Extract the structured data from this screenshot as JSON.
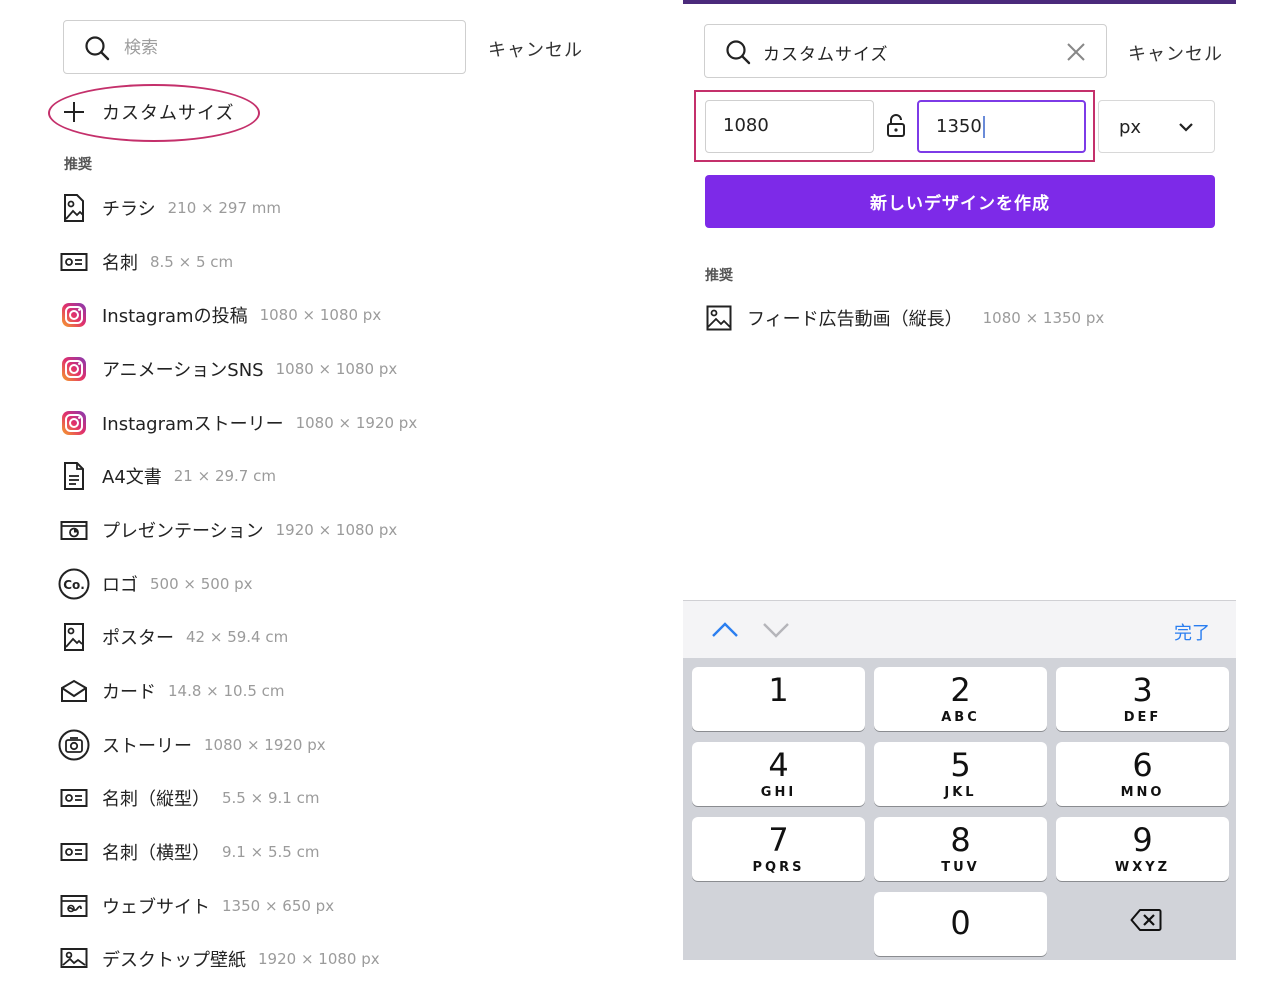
{
  "left_panel": {
    "search": {
      "placeholder": "検索",
      "value": ""
    },
    "cancel_label": "キャンセル",
    "custom_size_label": "カスタムサイズ",
    "section_heading": "推奨",
    "items": [
      {
        "icon": "flyer-icon",
        "name": "チラシ",
        "dims": "210 × 297 mm"
      },
      {
        "icon": "business-card-icon",
        "name": "名刺",
        "dims": "8.5 × 5 cm"
      },
      {
        "icon": "instagram-icon",
        "name": "Instagramの投稿",
        "dims": "1080 × 1080 px"
      },
      {
        "icon": "instagram-icon",
        "name": "アニメーションSNS",
        "dims": "1080 × 1080 px"
      },
      {
        "icon": "instagram-icon",
        "name": "Instagramストーリー",
        "dims": "1080 × 1920 px"
      },
      {
        "icon": "document-icon",
        "name": "A4文書",
        "dims": "21 × 29.7 cm"
      },
      {
        "icon": "presentation-icon",
        "name": "プレゼンテーション",
        "dims": "1920 × 1080 px"
      },
      {
        "icon": "logo-icon",
        "name": "ロゴ",
        "dims": "500 × 500 px"
      },
      {
        "icon": "poster-icon",
        "name": "ポスター",
        "dims": "42 × 59.4 cm"
      },
      {
        "icon": "card-icon",
        "name": "カード",
        "dims": "14.8 × 10.5 cm"
      },
      {
        "icon": "story-icon",
        "name": "ストーリー",
        "dims": "1080 × 1920 px"
      },
      {
        "icon": "business-card-icon",
        "name": "名刺（縦型）",
        "dims": "5.5 × 9.1 cm"
      },
      {
        "icon": "business-card-icon",
        "name": "名刺（横型）",
        "dims": "9.1 × 5.5 cm"
      },
      {
        "icon": "website-icon",
        "name": "ウェブサイト",
        "dims": "1350 × 650 px"
      },
      {
        "icon": "desktop-wallpaper-icon",
        "name": "デスクトップ壁紙",
        "dims": "1920 × 1080 px"
      }
    ]
  },
  "right_panel": {
    "search_value": "カスタムサイズ",
    "cancel_label": "キャンセル",
    "width_value": "1080",
    "height_value": "1350",
    "unit": "px",
    "create_button_label": "新しいデザインを作成",
    "section_heading": "推奨",
    "recommendation": {
      "icon": "image-icon",
      "name": "フィード広告動画（縦長）",
      "dims": "1080 × 1350 px"
    },
    "colors": {
      "accent": "#7d2ae8",
      "highlight": "#c4306b",
      "top_bar": "#4b2a7b"
    }
  },
  "keyboard": {
    "done_label": "完了",
    "keys": [
      {
        "digit": "1",
        "letters": ""
      },
      {
        "digit": "2",
        "letters": "ABC"
      },
      {
        "digit": "3",
        "letters": "DEF"
      },
      {
        "digit": "4",
        "letters": "GHI"
      },
      {
        "digit": "5",
        "letters": "JKL"
      },
      {
        "digit": "6",
        "letters": "MNO"
      },
      {
        "digit": "7",
        "letters": "PQRS"
      },
      {
        "digit": "8",
        "letters": "TUV"
      },
      {
        "digit": "9",
        "letters": "WXYZ"
      },
      {
        "digit": "0",
        "letters": ""
      }
    ]
  }
}
